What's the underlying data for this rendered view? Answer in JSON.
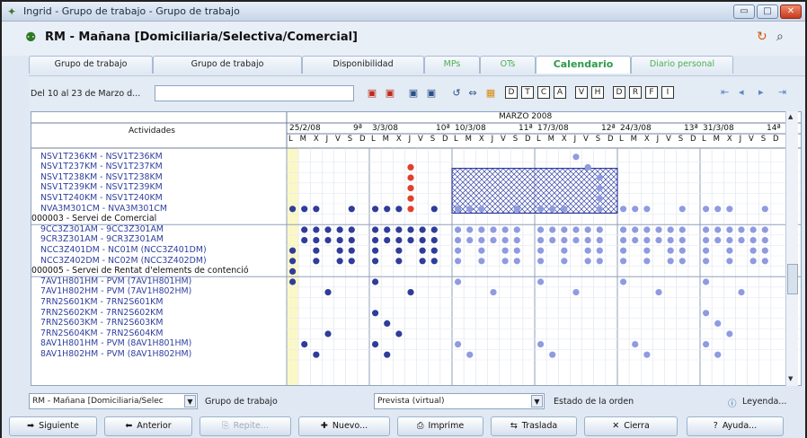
{
  "window": {
    "title": "Ingrid - Grupo de trabajo - Grupo de trabajo",
    "min": "▭",
    "max": "□",
    "close": "✕"
  },
  "header": {
    "title": "RM - Mañana [Domiciliaria/Selectiva/Comercial]"
  },
  "tabs": [
    {
      "label": "Grupo de trabajo",
      "w": 138
    },
    {
      "label": "Grupo de trabajo",
      "w": 166
    },
    {
      "label": "Disponibilidad",
      "w": 136
    },
    {
      "label": "MPs",
      "w": 62,
      "green": true
    },
    {
      "label": "OTs",
      "w": 62,
      "green": true
    },
    {
      "label": "Calendario",
      "w": 106,
      "active": true
    },
    {
      "label": "Diario personal",
      "w": 114,
      "green": true
    }
  ],
  "toolbar": {
    "date_label": "Del 10 al 23 de Marzo d...",
    "date_value": ""
  },
  "grid": {
    "activities_header": "Actividades",
    "month_label": "MARZO 2008",
    "weeks": [
      {
        "date": "25/2/08",
        "num": "9ª"
      },
      {
        "date": "3/3/08",
        "num": "10ª"
      },
      {
        "date": "10/3/08",
        "num": "11ª"
      },
      {
        "date": "17/3/08",
        "num": "12ª"
      },
      {
        "date": "24/3/08",
        "num": "13ª"
      },
      {
        "date": "31/3/08",
        "num": "14ª"
      }
    ],
    "weekdays": "L M X J V S D",
    "rows": [
      {
        "label": "NSV1T236KM - NSV1T236KM",
        "section": false
      },
      {
        "label": "NSV1T237KM - NSV1T237KM",
        "section": false
      },
      {
        "label": "NSV1T238KM - NSV1T238KM",
        "section": false
      },
      {
        "label": "NSV1T239KM - NSV1T239KM",
        "section": false
      },
      {
        "label": "NSV1T240KM - NSV1T240KM",
        "section": false
      },
      {
        "label": "NVA3M301CM - NVA3M301CM",
        "section": false
      },
      {
        "label": "000003 - Servei de Comercial",
        "section": true
      },
      {
        "label": "9CC3Z301AM - 9CC3Z301AM",
        "section": false
      },
      {
        "label": "9CR3Z301AM - 9CR3Z301AM",
        "section": false
      },
      {
        "label": "NCC3Z401DM - NC01M (NCC3Z401DM)",
        "section": false
      },
      {
        "label": "NCC3Z402DM - NC02M (NCC3Z402DM)",
        "section": false
      },
      {
        "label": "000005 - Servei de Rentat d'elements de contenció",
        "section": true
      },
      {
        "label": "7AV1H801HM - PVM (7AV1H801HM)",
        "section": false
      },
      {
        "label": "7AV1H802HM - PVM (7AV1H802HM)",
        "section": false
      },
      {
        "label": "7RN2S601KM - 7RN2S601KM",
        "section": false
      },
      {
        "label": "7RN2S602KM - 7RN2S602KM",
        "section": false
      },
      {
        "label": "7RN2S603KM - 7RN2S603KM",
        "section": false
      },
      {
        "label": "7RN2S604KM - 7RN2S604KM",
        "section": false
      },
      {
        "label": "8AV1H801HM - PVM (8AV1H801HM)",
        "section": false
      },
      {
        "label": "8AV1H802HM - PVM (8AV1H802HM)",
        "section": false
      }
    ],
    "colors": {
      "dark": "#2f3c9a",
      "light": "#8f9be0",
      "red": "#e2402a",
      "today": "#fbf8c8"
    }
  },
  "bottom": {
    "group_select": "RM - Mañana [Domiciliaria/Selec",
    "group_label": "Grupo de trabajo",
    "order_select": "Prevista (virtual)",
    "order_label": "Estado de la orden",
    "legend_link": "Leyenda..."
  },
  "buttons": [
    {
      "label": "Siguiente",
      "icon": "➡",
      "disabled": false
    },
    {
      "label": "Anterior",
      "icon": "⬅",
      "disabled": false
    },
    {
      "label": "Repite...",
      "icon": "⎘",
      "disabled": true
    },
    {
      "label": "Nuevo...",
      "icon": "✚",
      "disabled": false
    },
    {
      "label": "Imprime",
      "icon": "⎙",
      "disabled": false
    },
    {
      "label": "Traslada",
      "icon": "⇆",
      "disabled": false
    },
    {
      "label": "Cierra",
      "icon": "✕",
      "disabled": false
    },
    {
      "label": "Ayuda...",
      "icon": "?",
      "disabled": false
    }
  ]
}
